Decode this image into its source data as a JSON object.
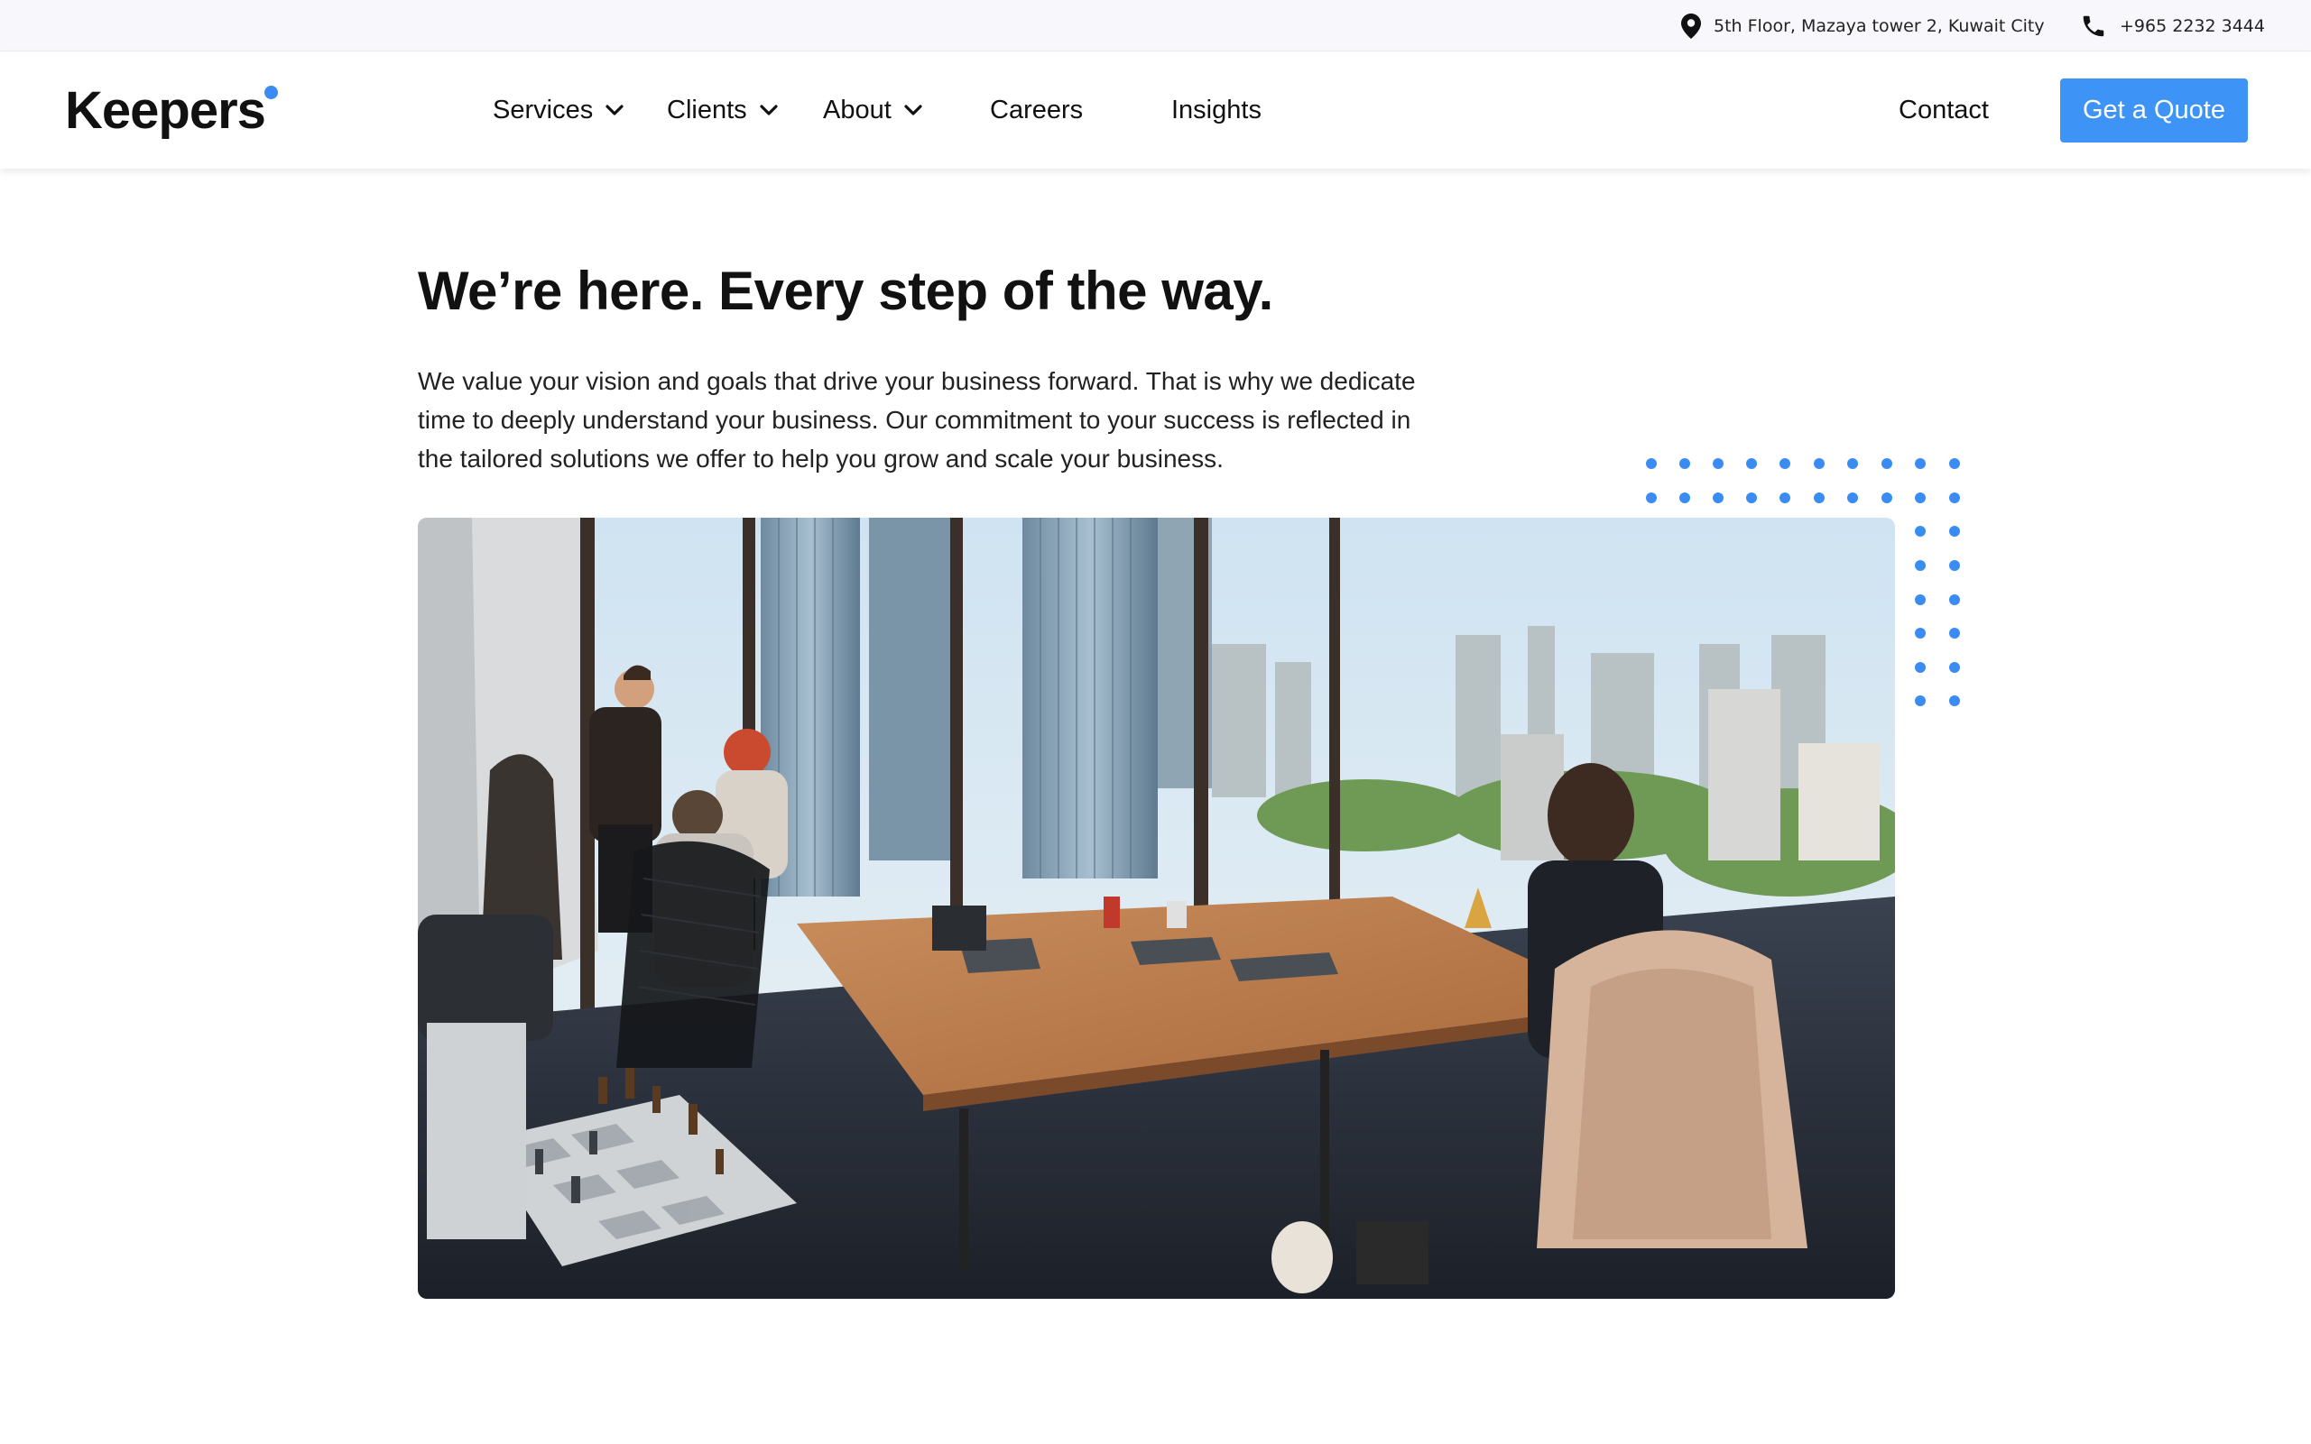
{
  "topbar": {
    "address_icon": "map-pin-icon",
    "address": "5th Floor, Mazaya tower 2, Kuwait City",
    "phone_icon": "phone-icon",
    "phone": "+965 2232 3444"
  },
  "header": {
    "logo_text": "Keepers",
    "nav": {
      "services": "Services",
      "clients": "Clients",
      "about": "About",
      "careers": "Careers",
      "insights": "Insights"
    },
    "contact": "Contact",
    "cta": "Get a Quote"
  },
  "hero": {
    "title": "We’re here. Every step of the way.",
    "body": "We value your vision and goals that drive your business forward. That is why we dedicate time to deeply understand your business. Our commitment to your success is reflected in the tailored solutions we offer to help you grow and scale your business."
  },
  "colors": {
    "accent": "#3d94f6",
    "dot": "#3b8cf2",
    "text": "#111111",
    "topbar_bg": "#f8f7fb"
  }
}
